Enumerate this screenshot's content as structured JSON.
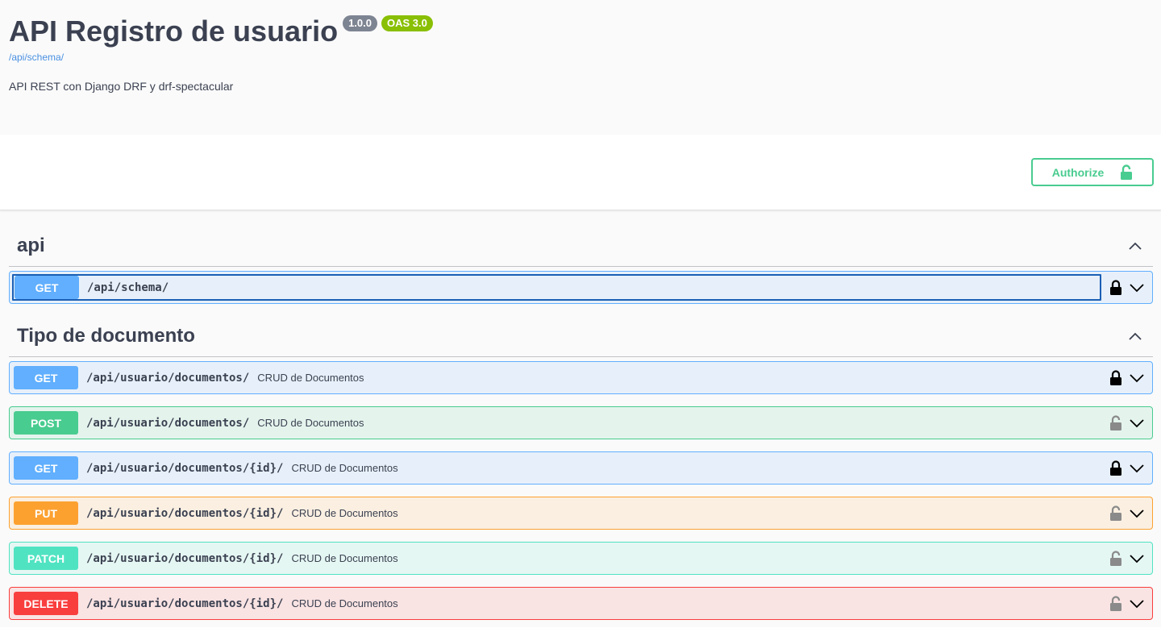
{
  "info": {
    "title": "API Registro de usuario",
    "version": "1.0.0",
    "oas": "OAS 3.0",
    "schema_link": "/api/schema/",
    "description": "API REST con Django DRF y drf-spectacular"
  },
  "scheme": {
    "authorize_label": "Authorize"
  },
  "colors": {
    "get": "#61affe",
    "post": "#49cc90",
    "put": "#fca130",
    "patch": "#50e3c2",
    "delete": "#f93e3e",
    "authorize": "#49cc90"
  },
  "tags": [
    {
      "name": "api",
      "operations": [
        {
          "method": "GET",
          "path": "/api/schema/",
          "summary": "",
          "locked": true
        }
      ]
    },
    {
      "name": "Tipo de documento",
      "operations": [
        {
          "method": "GET",
          "path": "/api/usuario/documentos/",
          "summary": "CRUD de Documentos",
          "locked": true
        },
        {
          "method": "POST",
          "path": "/api/usuario/documentos/",
          "summary": "CRUD de Documentos",
          "locked": false
        },
        {
          "method": "GET",
          "path": "/api/usuario/documentos/{id}/",
          "summary": "CRUD de Documentos",
          "locked": true
        },
        {
          "method": "PUT",
          "path": "/api/usuario/documentos/{id}/",
          "summary": "CRUD de Documentos",
          "locked": false
        },
        {
          "method": "PATCH",
          "path": "/api/usuario/documentos/{id}/",
          "summary": "CRUD de Documentos",
          "locked": false
        },
        {
          "method": "DELETE",
          "path": "/api/usuario/documentos/{id}/",
          "summary": "CRUD de Documentos",
          "locked": false
        }
      ]
    }
  ]
}
